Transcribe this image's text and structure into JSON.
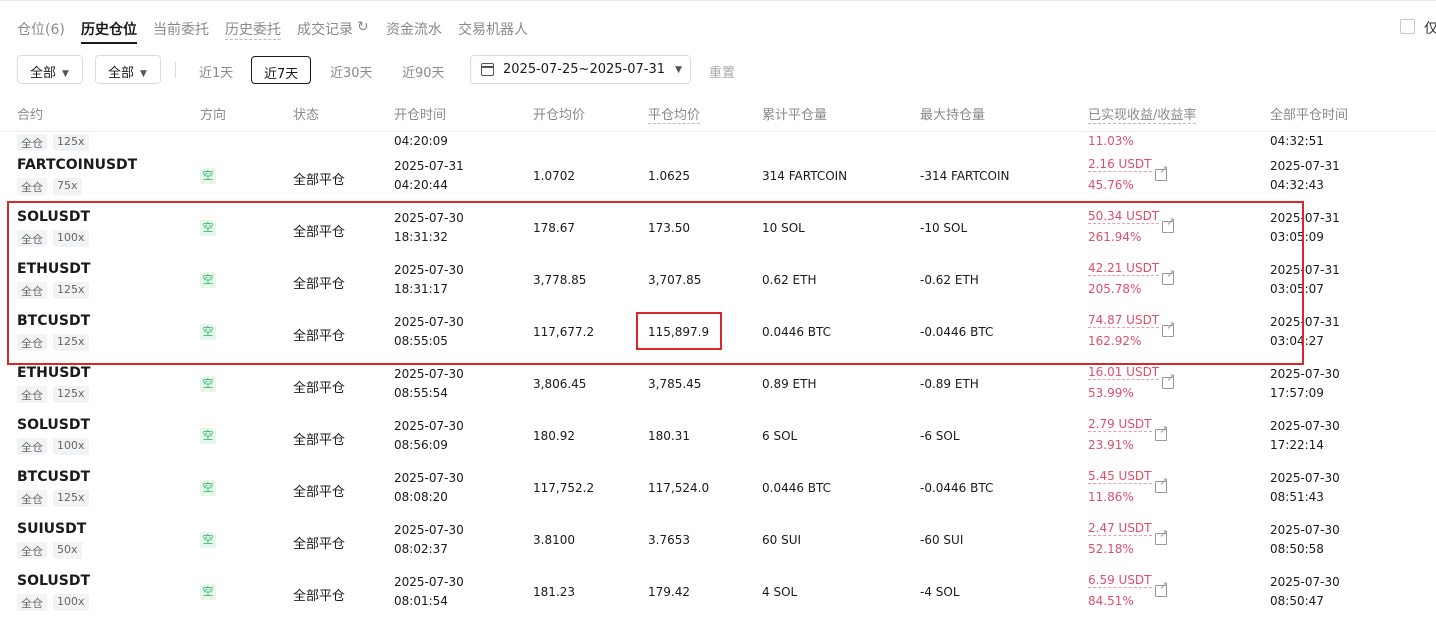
{
  "tabs": [
    {
      "label": "仓位(6)"
    },
    {
      "label": "历史仓位"
    },
    {
      "label": "当前委托"
    },
    {
      "label": "历史委托"
    },
    {
      "label": "成交记录"
    },
    {
      "label": "资金流水"
    },
    {
      "label": "交易机器人"
    }
  ],
  "only_label": "仅",
  "filters": {
    "dropdown1": "全部",
    "dropdown2": "全部",
    "ranges": [
      "近1天",
      "近7天",
      "近30天",
      "近90天"
    ],
    "date_range": "2025-07-25~2025-07-31",
    "reset": "重置"
  },
  "columns": [
    "合约",
    "方向",
    "状态",
    "开仓时间",
    "开仓均价",
    "平仓均价",
    "累计平仓量",
    "最大持仓量",
    "已实现收益/收益率",
    "全部平仓时间"
  ],
  "partial_row": {
    "margin": "全仓",
    "leverage": "125x",
    "open_time": "04:20:09",
    "rate": "11.03%",
    "close_time": "04:32:51"
  },
  "rows": [
    {
      "symbol": "FARTCOINUSDT",
      "margin": "全仓",
      "leverage": "75x",
      "direction": "空",
      "status": "全部平仓",
      "open_date": "2025-07-31",
      "open_time": "04:20:44",
      "open_avg": "1.0702",
      "close_avg": "1.0625",
      "closed_qty": "314 FARTCOIN",
      "max_qty": "-314 FARTCOIN",
      "pnl": "2.16 USDT",
      "rate": "45.76%",
      "close_date": "2025-07-31",
      "close_time": "04:32:43"
    },
    {
      "symbol": "SOLUSDT",
      "margin": "全仓",
      "leverage": "100x",
      "direction": "空",
      "status": "全部平仓",
      "open_date": "2025-07-30",
      "open_time": "18:31:32",
      "open_avg": "178.67",
      "close_avg": "173.50",
      "closed_qty": "10 SOL",
      "max_qty": "-10 SOL",
      "pnl": "50.34 USDT",
      "rate": "261.94%",
      "close_date": "2025-07-31",
      "close_time": "03:05:09"
    },
    {
      "symbol": "ETHUSDT",
      "margin": "全仓",
      "leverage": "125x",
      "direction": "空",
      "status": "全部平仓",
      "open_date": "2025-07-30",
      "open_time": "18:31:17",
      "open_avg": "3,778.85",
      "close_avg": "3,707.85",
      "closed_qty": "0.62 ETH",
      "max_qty": "-0.62 ETH",
      "pnl": "42.21 USDT",
      "rate": "205.78%",
      "close_date": "2025-07-31",
      "close_time": "03:05:07"
    },
    {
      "symbol": "BTCUSDT",
      "margin": "全仓",
      "leverage": "125x",
      "direction": "空",
      "status": "全部平仓",
      "open_date": "2025-07-30",
      "open_time": "08:55:05",
      "open_avg": "117,677.2",
      "close_avg": "115,897.9",
      "closed_qty": "0.0446 BTC",
      "max_qty": "-0.0446 BTC",
      "pnl": "74.87 USDT",
      "rate": "162.92%",
      "close_date": "2025-07-31",
      "close_time": "03:04:27"
    },
    {
      "symbol": "ETHUSDT",
      "margin": "全仓",
      "leverage": "125x",
      "direction": "空",
      "status": "全部平仓",
      "open_date": "2025-07-30",
      "open_time": "08:55:54",
      "open_avg": "3,806.45",
      "close_avg": "3,785.45",
      "closed_qty": "0.89 ETH",
      "max_qty": "-0.89 ETH",
      "pnl": "16.01 USDT",
      "rate": "53.99%",
      "close_date": "2025-07-30",
      "close_time": "17:57:09"
    },
    {
      "symbol": "SOLUSDT",
      "margin": "全仓",
      "leverage": "100x",
      "direction": "空",
      "status": "全部平仓",
      "open_date": "2025-07-30",
      "open_time": "08:56:09",
      "open_avg": "180.92",
      "close_avg": "180.31",
      "closed_qty": "6 SOL",
      "max_qty": "-6 SOL",
      "pnl": "2.79 USDT",
      "rate": "23.91%",
      "close_date": "2025-07-30",
      "close_time": "17:22:14"
    },
    {
      "symbol": "BTCUSDT",
      "margin": "全仓",
      "leverage": "125x",
      "direction": "空",
      "status": "全部平仓",
      "open_date": "2025-07-30",
      "open_time": "08:08:20",
      "open_avg": "117,752.2",
      "close_avg": "117,524.0",
      "closed_qty": "0.0446 BTC",
      "max_qty": "-0.0446 BTC",
      "pnl": "5.45 USDT",
      "rate": "11.86%",
      "close_date": "2025-07-30",
      "close_time": "08:51:43"
    },
    {
      "symbol": "SUIUSDT",
      "margin": "全仓",
      "leverage": "50x",
      "direction": "空",
      "status": "全部平仓",
      "open_date": "2025-07-30",
      "open_time": "08:02:37",
      "open_avg": "3.8100",
      "close_avg": "3.7653",
      "closed_qty": "60 SUI",
      "max_qty": "-60 SUI",
      "pnl": "2.47 USDT",
      "rate": "52.18%",
      "close_date": "2025-07-30",
      "close_time": "08:50:58"
    },
    {
      "symbol": "SOLUSDT",
      "margin": "全仓",
      "leverage": "100x",
      "direction": "空",
      "status": "全部平仓",
      "open_date": "2025-07-30",
      "open_time": "08:01:54",
      "open_avg": "181.23",
      "close_avg": "179.42",
      "closed_qty": "4 SOL",
      "max_qty": "-4 SOL",
      "pnl": "6.59 USDT",
      "rate": "84.51%",
      "close_date": "2025-07-30",
      "close_time": "08:50:47"
    }
  ]
}
